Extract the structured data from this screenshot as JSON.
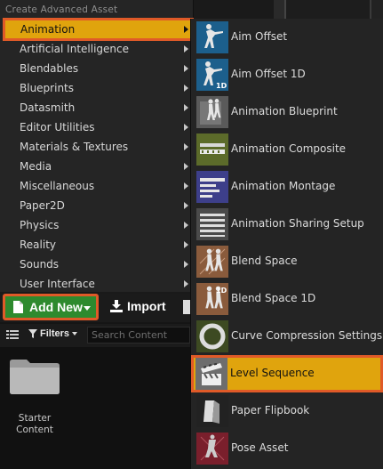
{
  "menu": {
    "header": "Create Advanced Asset",
    "categories": [
      {
        "label": "Animation",
        "selected": true
      },
      {
        "label": "Artificial Intelligence"
      },
      {
        "label": "Blendables"
      },
      {
        "label": "Blueprints"
      },
      {
        "label": "Datasmith"
      },
      {
        "label": "Editor Utilities"
      },
      {
        "label": "Materials & Textures"
      },
      {
        "label": "Media"
      },
      {
        "label": "Miscellaneous"
      },
      {
        "label": "Paper2D"
      },
      {
        "label": "Physics"
      },
      {
        "label": "Reality"
      },
      {
        "label": "Sounds"
      },
      {
        "label": "User Interface"
      }
    ]
  },
  "submenu": {
    "items": [
      {
        "label": "Aim Offset",
        "icon": "aim-offset-icon"
      },
      {
        "label": "Aim Offset 1D",
        "icon": "aim-offset-1d-icon"
      },
      {
        "label": "Animation Blueprint",
        "icon": "animation-blueprint-icon"
      },
      {
        "label": "Animation Composite",
        "icon": "animation-composite-icon"
      },
      {
        "label": "Animation Montage",
        "icon": "animation-montage-icon"
      },
      {
        "label": "Animation Sharing Setup",
        "icon": "animation-sharing-setup-icon"
      },
      {
        "label": "Blend Space",
        "icon": "blend-space-icon"
      },
      {
        "label": "Blend Space 1D",
        "icon": "blend-space-1d-icon"
      },
      {
        "label": "Curve Compression Settings",
        "icon": "curve-compression-icon"
      },
      {
        "label": "Level Sequence",
        "icon": "level-sequence-icon",
        "selected": true
      },
      {
        "label": "Paper Flipbook",
        "icon": "paper-flipbook-icon"
      },
      {
        "label": "Pose Asset",
        "icon": "pose-asset-icon"
      }
    ],
    "badge_1d": "1D"
  },
  "toolbar": {
    "add_new_label": "Add New",
    "import_label": "Import"
  },
  "filter_bar": {
    "filters_label": "Filters",
    "search_placeholder": "Search Content"
  },
  "content": {
    "folder_label": "Starter Content"
  },
  "colors": {
    "selected_bg": "#e0a40d",
    "highlight_outline": "#e05a28",
    "add_new_green": "#2e8a2e"
  }
}
